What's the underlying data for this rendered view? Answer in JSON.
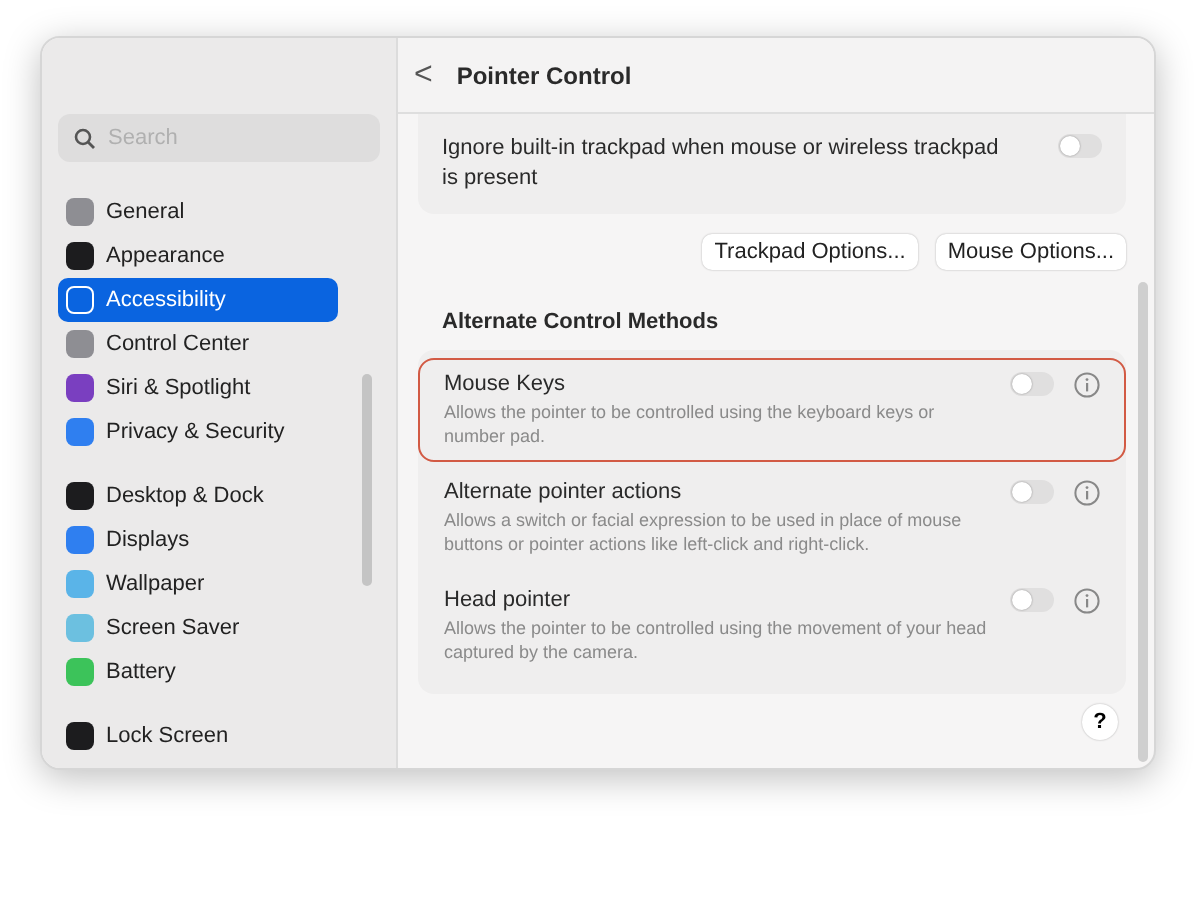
{
  "sidebar": {
    "search": {
      "placeholder": "Search"
    },
    "groups": [
      {
        "items": [
          {
            "label": "General",
            "selected": false,
            "color": "#8e8e93"
          },
          {
            "label": "Appearance",
            "selected": false,
            "color": "#1c1c1e"
          },
          {
            "label": "Accessibility",
            "selected": true,
            "color": "#0a64e0"
          },
          {
            "label": "Control Center",
            "selected": false,
            "color": "#8e8e93"
          },
          {
            "label": "Siri & Spotlight",
            "selected": false,
            "color": "#7a3fc0"
          },
          {
            "label": "Privacy & Security",
            "selected": false,
            "color": "#2f7ff0"
          }
        ]
      },
      {
        "items": [
          {
            "label": "Desktop & Dock",
            "selected": false,
            "color": "#1c1c1e"
          },
          {
            "label": "Displays",
            "selected": false,
            "color": "#2f7ff0"
          },
          {
            "label": "Wallpaper",
            "selected": false,
            "color": "#5ab4e8"
          },
          {
            "label": "Screen Saver",
            "selected": false,
            "color": "#6cc0e0"
          },
          {
            "label": "Battery",
            "selected": false,
            "color": "#3cc35a"
          }
        ]
      },
      {
        "items": [
          {
            "label": "Lock Screen",
            "selected": false,
            "color": "#1c1c1e"
          }
        ]
      }
    ]
  },
  "header": {
    "back": "<",
    "title": "Pointer Control"
  },
  "trackpad_row": {
    "label": "Ignore built-in trackpad when mouse or wireless trackpad is present",
    "on": false
  },
  "buttons": [
    "Trackpad Options...",
    "Mouse Options..."
  ],
  "section_title": "Alternate Control Methods",
  "methods": [
    {
      "title": "Mouse Keys",
      "description": "Allows the pointer to be controlled using the keyboard keys or number pad.",
      "on": false,
      "highlighted": true
    },
    {
      "title": "Alternate pointer actions",
      "description": "Allows a switch or facial expression to be used in place of mouse buttons or pointer actions like left-click and right-click.",
      "on": false,
      "highlighted": false
    },
    {
      "title": "Head pointer",
      "description": "Allows the pointer to be controlled using the movement of your head captured by the camera.",
      "on": false,
      "highlighted": false
    }
  ],
  "help": "?"
}
